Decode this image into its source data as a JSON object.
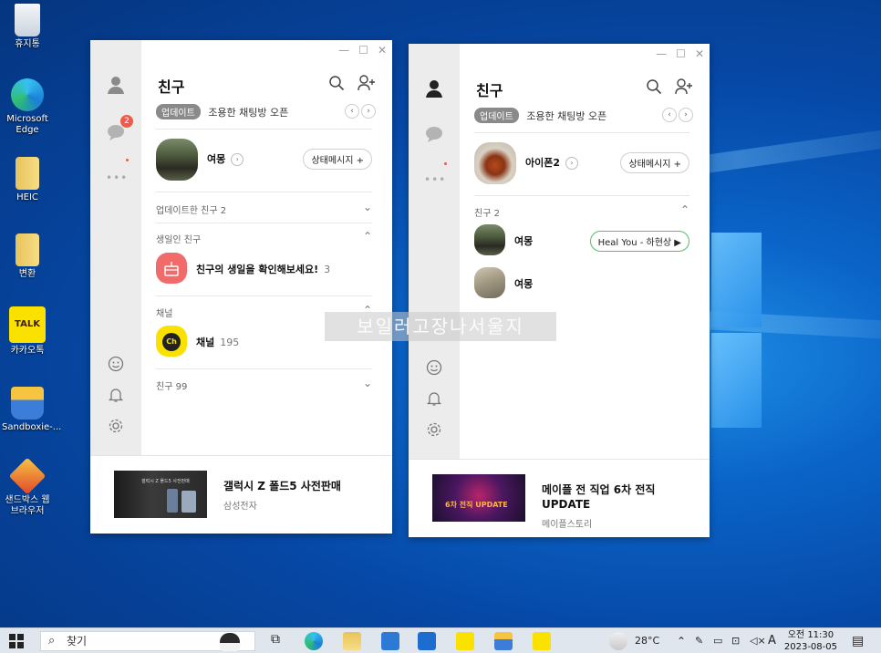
{
  "desktop": {
    "icons": [
      {
        "label": "휴지통",
        "icon": "recycle-bin-icon"
      },
      {
        "label": "Microsoft Edge",
        "icon": "edge-icon"
      },
      {
        "label": "HEIC",
        "icon": "folder-icon"
      },
      {
        "label": "변환",
        "icon": "folder-icon"
      },
      {
        "label": "카카오톡",
        "icon": "kakaotalk-icon"
      },
      {
        "label": "Sandboxie-...",
        "icon": "sandboxie-icon"
      },
      {
        "label": "샌드박스 웹 브라우저",
        "icon": "sandbox-browser-icon"
      }
    ]
  },
  "window_left": {
    "title": "친구",
    "chat_badge": "2",
    "notice_tag": "업데이트",
    "notice_text": "조용한 채팅방 오픈",
    "profile_name": "여몽",
    "status_button": "상태메시지 +",
    "updated_friends": "업데이트한 친구  2",
    "birthday_section": "생일인 친구",
    "birthday_text": "친구의 생일을 확인해보세요!",
    "birthday_count": "3",
    "channel_section": "채널",
    "channel_name": "채널",
    "channel_count": "195",
    "friends_section": "친구  99",
    "ad_title": "갤럭시 Z 폴드5 사전판매",
    "ad_sub": "삼성전자",
    "ad_banner_text": "갤럭시 Z 폴드5 사전판매"
  },
  "window_right": {
    "title": "친구",
    "notice_tag": "업데이트",
    "notice_text": "조용한 채팅방 오픈",
    "profile_name": "아이폰2",
    "status_button": "상태메시지 +",
    "friends_section": "친구  2",
    "friend1_name": "여몽",
    "friend1_music": "Heal You - 하현상 ▶",
    "friend2_name": "여몽",
    "ad_title": "메이플 전 직업 6차 전직 UPDATE",
    "ad_sub": "메이플스토리",
    "ad_banner_text": "6차 전직 UPDATE"
  },
  "watermark": "보일러고장나서울지",
  "taskbar": {
    "search_placeholder": "찾기",
    "weather": "28°C",
    "ime": "A",
    "clock_time": "오전 11:30",
    "clock_date": "2023-08-05"
  },
  "colors": {
    "kakao_yellow": "#fae100",
    "badge_red": "#f05a4a",
    "music_green": "#4cc46a"
  }
}
